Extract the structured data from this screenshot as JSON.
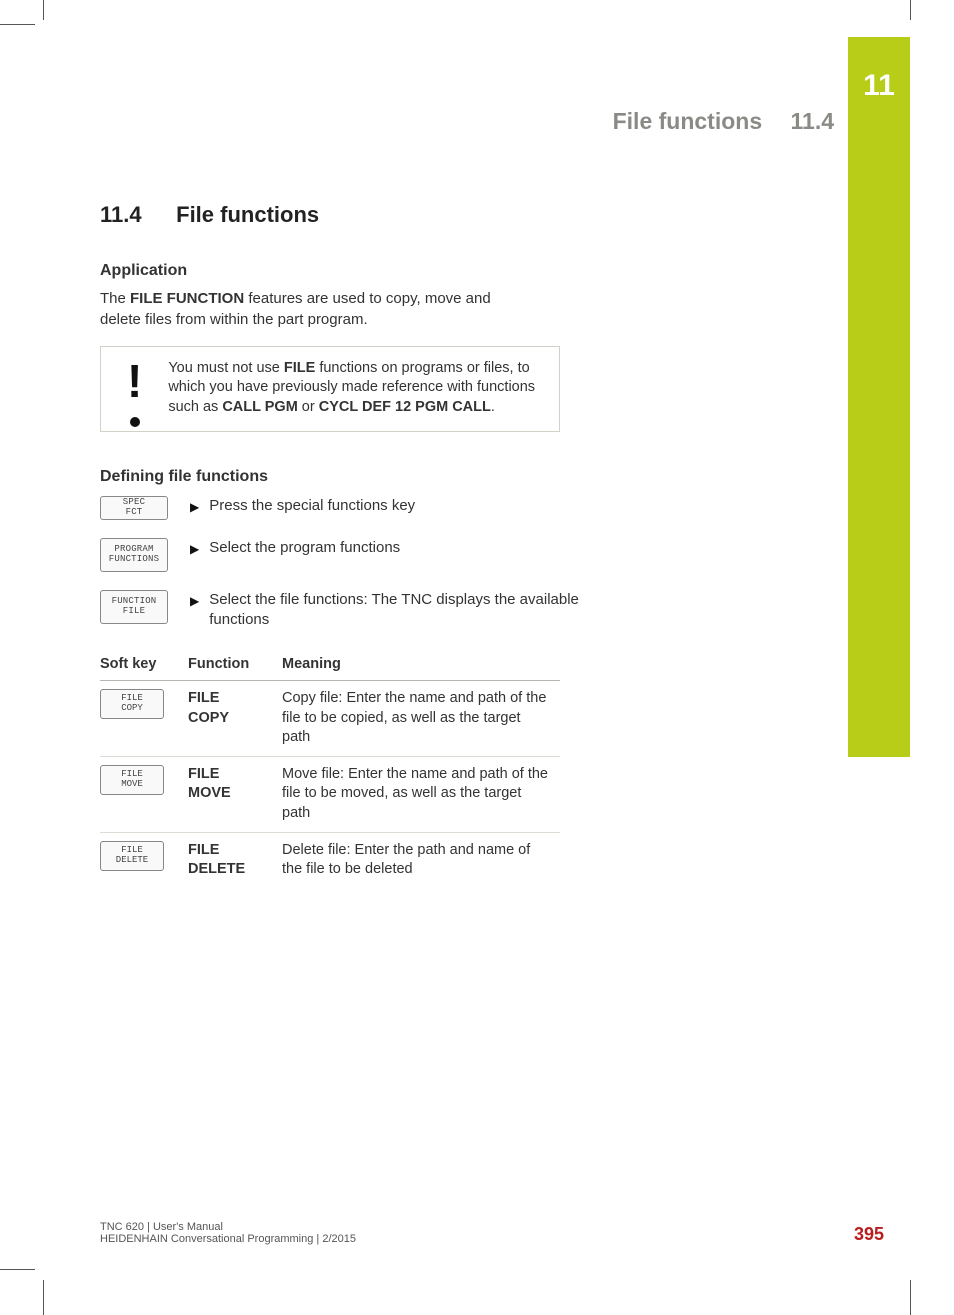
{
  "chapter_tab": "11",
  "running_header": {
    "title": "File functions",
    "section": "11.4"
  },
  "section": {
    "number": "11.4",
    "title": "File functions"
  },
  "application": {
    "heading": "Application",
    "text_before": "The ",
    "text_bold": "FILE FUNCTION",
    "text_after": " features are used to copy, move and delete files from within the part program."
  },
  "warning": {
    "pre": "You must not use ",
    "b1": "FILE",
    "mid1": " functions on programs or files, to which you have previously made reference with functions such as ",
    "b2": "CALL PGM",
    "mid2": " or ",
    "b3": "CYCL DEF 12 PGM CALL",
    "post": "."
  },
  "defining": {
    "heading": "Defining file functions",
    "steps": [
      {
        "key_l1": "SPEC",
        "key_l2": "FCT",
        "size": "small",
        "desc": "Press the special functions key"
      },
      {
        "key_l1": "PROGRAM",
        "key_l2": "FUNCTIONS",
        "size": "medium",
        "desc": "Select the program functions"
      },
      {
        "key_l1": "FUNCTION",
        "key_l2": "FILE",
        "size": "medium",
        "desc": "Select the file functions: The TNC displays the available functions"
      }
    ]
  },
  "table": {
    "headers": {
      "softkey": "Soft key",
      "function": "Function",
      "meaning": "Meaning"
    },
    "rows": [
      {
        "sk_l1": "FILE",
        "sk_l2": "COPY",
        "fn_l1": "FILE",
        "fn_l2": "COPY",
        "meaning": "Copy file: Enter the name and path of the file to be copied, as well as the target path"
      },
      {
        "sk_l1": "FILE",
        "sk_l2": "MOVE",
        "fn_l1": "FILE",
        "fn_l2": "MOVE",
        "meaning": "Move file: Enter the name and path of the file to be moved, as well as the target path"
      },
      {
        "sk_l1": "FILE",
        "sk_l2": "DELETE",
        "fn_l1": "FILE",
        "fn_l2": "DELETE",
        "meaning": "Delete file: Enter the path and name of the file to be deleted"
      }
    ]
  },
  "footer": {
    "line1": "TNC 620 | User's Manual",
    "line2": "HEIDENHAIN Conversational Programming | 2/2015",
    "page": "395"
  }
}
